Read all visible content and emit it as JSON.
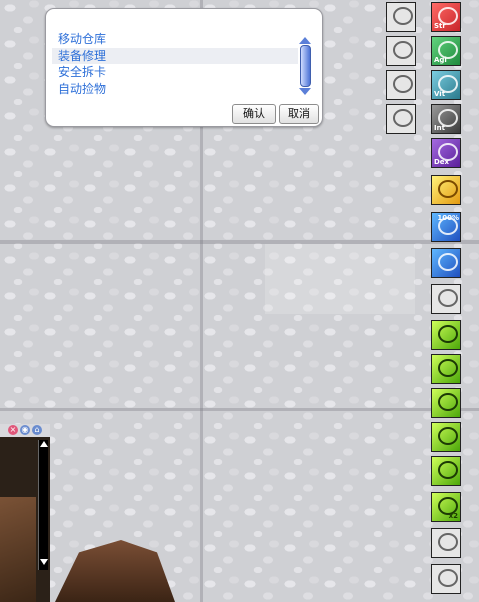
{
  "dialog": {
    "options": [
      "移动仓库",
      "装备修理",
      "安全拆卡",
      "自动捡物"
    ],
    "confirm_label": "确认",
    "cancel_label": "取消"
  },
  "skills": {
    "stat_labels": [
      "Str",
      "Agi",
      "Vit",
      "Int",
      "Dex"
    ],
    "percent_label": "100%",
    "badge_label": "x2"
  },
  "colors": {
    "str": "#c8242a",
    "agi": "#1f8a3d",
    "vit": "#2a7a8c",
    "int": "#4c4c4c",
    "dex": "#6a2aa8",
    "skill_green": "#7fd420",
    "skill_blue": "#2e6fd8"
  }
}
